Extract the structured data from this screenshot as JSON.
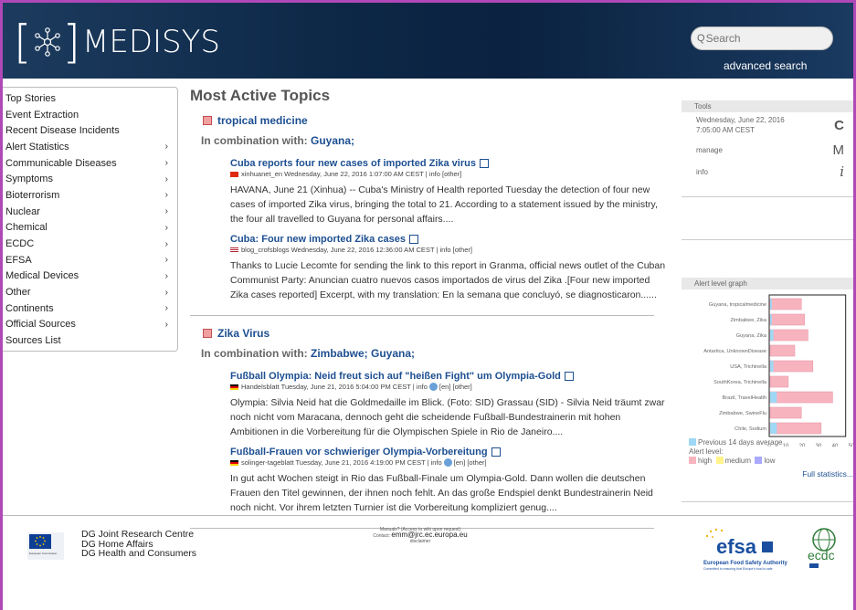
{
  "header": {
    "logo_text": "MEDISYS",
    "search_placeholder": "Search",
    "advanced_search": "advanced search"
  },
  "nav": {
    "items": [
      {
        "label": "Top Stories",
        "arrow": false
      },
      {
        "label": "Event Extraction",
        "arrow": false
      },
      {
        "label": "Recent Disease Incidents",
        "arrow": false
      },
      {
        "label": "Alert Statistics",
        "arrow": true
      },
      {
        "label": "Communicable Diseases",
        "arrow": true
      },
      {
        "label": "Symptoms",
        "arrow": true
      },
      {
        "label": "Bioterrorism",
        "arrow": true
      },
      {
        "label": "Nuclear",
        "arrow": true
      },
      {
        "label": "Chemical",
        "arrow": true
      },
      {
        "label": "ECDC",
        "arrow": true
      },
      {
        "label": "EFSA",
        "arrow": true
      },
      {
        "label": "Medical Devices",
        "arrow": true
      },
      {
        "label": "Other",
        "arrow": true
      },
      {
        "label": "Continents",
        "arrow": true
      },
      {
        "label": "Official Sources",
        "arrow": true
      },
      {
        "label": "Sources List",
        "arrow": false
      }
    ],
    "arrow_glyph": "›"
  },
  "main": {
    "title": "Most Active Topics",
    "combo_label": "In combination with:",
    "topics": [
      {
        "name": "tropical medicine",
        "combo": "Guyana;",
        "articles": [
          {
            "title": "Cuba reports four new cases of imported Zika virus",
            "meta": "xinhuanet_en Wednesday, June 22, 2016 1:07:00 AM CEST | info [other]",
            "flag": "cn",
            "body": "HAVANA, June 21 (Xinhua) -- Cuba's Ministry of Health reported Tuesday the detection of four new cases of imported Zika virus, bringing the total to 21. According to a statement issued by the ministry, the four all travelled to Guyana for personal affairs...."
          },
          {
            "title": "Cuba: Four new imported Zika cases",
            "meta": "blog_crofsblogs Wednesday, June 22, 2016 12:36:00 AM CEST | info [other]",
            "flag": "us",
            "body": "Thanks to Lucie Lecomte for sending the link to this report in Granma, official news outlet of the Cuban Communist Party: Anuncian cuatro nuevos casos importados de virus del Zika .[Four new imported Zika cases reported] Excerpt, with my translation: En la semana que concluyó, se diagnosticaron......"
          }
        ]
      },
      {
        "name": "Zika Virus",
        "combo": "Zimbabwe; Guyana;",
        "articles": [
          {
            "title": "Fußball Olympia: Neid freut sich auf \"heißen Fight\" um Olympia-Gold",
            "meta_a": "Handelsblatt Tuesday, June 21, 2016 5:04:00 PM CEST | info",
            "meta_b": "[en] [other]",
            "flag": "de",
            "body": "Olympia: Silvia Neid hat die Goldmedaille im Blick. (Foto: SID) Grassau (SID) - Silvia Neid träumt zwar noch nicht vom Maracana, dennoch geht die scheidende Fußball-Bundestrainerin mit hohen Ambitionen in die Vorbereitung für die Olympischen Spiele in Rio de Janeiro...."
          },
          {
            "title": "Fußball-Frauen vor schwieriger Olympia-Vorbereitung",
            "meta_a": "solinger-tageblatt Tuesday, June 21, 2016 4:19:00 PM CEST | info",
            "meta_b": "[en] [other]",
            "flag": "de",
            "body": "In gut acht Wochen steigt in Rio das Fußball-Finale um Olympia-Gold. Dann wollen die deutschen Frauen den Titel gewinnen, der ihnen noch fehlt. An das große Endspiel denkt Bundestrainerin Neid noch nicht. Vor ihrem letzten Turnier ist die Vorbereitung kompliziert genug...."
          }
        ]
      }
    ]
  },
  "tools": {
    "title": "Tools",
    "date": "Wednesday, June 22, 2016",
    "time": "7:05:00 AM CEST",
    "manage": "manage",
    "info": "info",
    "refresh_glyph": "C",
    "manage_glyph": "M",
    "info_glyph": "i"
  },
  "alert": {
    "title": "Alert level graph",
    "previous_label": "Previous 14 days average",
    "alert_level_label": "Alert level:",
    "high": "high",
    "medium": "medium",
    "low": "low",
    "full_stats": "Full statistics...",
    "colors": {
      "high": "#f7b4bf",
      "medium": "#fff38a",
      "low": "#a9a9ff",
      "previous": "#9fd8f4"
    }
  },
  "chart_data": {
    "type": "bar",
    "orientation": "horizontal",
    "categories": [
      "Guyana, tropicalmedicine",
      "Zimbabwe, Zika",
      "Guyana, Zika",
      "Antartica, UnknownDisease",
      "USA, Trichinella",
      "SouthKorea, Trichinella",
      "Brazil, TravelHealth",
      "Zimbabwe, SwineFlu",
      "Chile, Sodium"
    ],
    "series": [
      {
        "name": "Previous 14 days average",
        "values": [
          1,
          1,
          2,
          0,
          2,
          0,
          4,
          0,
          4
        ]
      },
      {
        "name": "high",
        "values": [
          19,
          21,
          23,
          15,
          26,
          11,
          38,
          19,
          31
        ]
      }
    ],
    "xticks": [
      "0",
      "10",
      "20",
      "30",
      "40",
      "50"
    ],
    "xlim": [
      0,
      50
    ]
  },
  "footer": {
    "org_lines": [
      "DG Joint Research Centre",
      "DG Home Affairs",
      "DG Health and Consumers"
    ],
    "contact_line1": "Manuals? (Access to wiki upon request)",
    "contact_label": "Contact:",
    "email": "emm@jrc.ec.europa.eu",
    "disclaimer": "disclaimer",
    "efsa_text": "efsa",
    "efsa_caption": "European Food Safety Authority",
    "efsa_sub": "Committed to ensuring that Europe's food is safe",
    "ecdc_text": "ecdc",
    "ec_caption": "European Commission"
  }
}
